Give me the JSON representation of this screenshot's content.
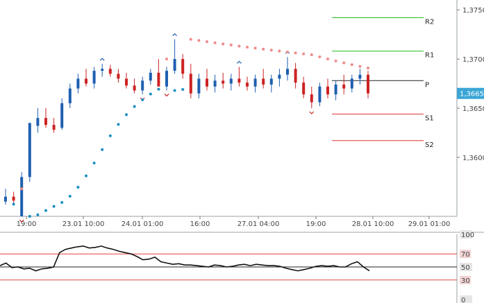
{
  "chart_data": [
    {
      "type": "candlestick",
      "title": "",
      "price_axis": {
        "ticks": [
          "1,3750",
          "1,3700",
          "1,3650",
          "1,3600"
        ],
        "tick_values": [
          1.375,
          1.37,
          1.365,
          1.36
        ],
        "current_price_label": "1,3665",
        "current_price": 1.3665,
        "ylim": [
          1.354,
          1.376
        ]
      },
      "time_axis": {
        "ticks": [
          "19:00",
          "23.01 10:00",
          "24.01 01:00",
          "16:00",
          "27.01 04:00",
          "19:00",
          "28.01 10:00",
          "29.01 01:00"
        ]
      },
      "pivot_levels": [
        {
          "label": "R2",
          "value": 1.3742,
          "color": "#22bb22"
        },
        {
          "label": "R1",
          "value": 1.3708,
          "color": "#22bb22"
        },
        {
          "label": "P",
          "value": 1.3678,
          "color": "#222222"
        },
        {
          "label": "S1",
          "value": 1.3644,
          "color": "#dd3333"
        },
        {
          "label": "S2",
          "value": 1.3617,
          "color": "#dd3333"
        }
      ],
      "colors": {
        "bull": "#1f5fb0",
        "bear": "#cc2222",
        "sar_down": "#ef8a8a",
        "sar_up": "#1a8fc4"
      },
      "candles": [
        [
          1.3555,
          1.3568,
          1.3552,
          1.356
        ],
        [
          1.356,
          1.3565,
          1.3553,
          1.3556
        ],
        [
          1.354,
          1.3585,
          1.354,
          1.358
        ],
        [
          1.358,
          1.362,
          1.3575,
          1.3635
        ],
        [
          1.3632,
          1.365,
          1.3625,
          1.364
        ],
        [
          1.364,
          1.365,
          1.363,
          1.3633
        ],
        [
          1.3633,
          1.364,
          1.3625,
          1.3628
        ],
        [
          1.363,
          1.366,
          1.3628,
          1.3655
        ],
        [
          1.3655,
          1.3675,
          1.365,
          1.367
        ],
        [
          1.367,
          1.3685,
          1.3665,
          1.368
        ],
        [
          1.368,
          1.369,
          1.3672,
          1.3675
        ],
        [
          1.3675,
          1.3692,
          1.367,
          1.3688
        ],
        [
          1.3688,
          1.3695,
          1.3682,
          1.369
        ],
        [
          1.369,
          1.3694,
          1.3682,
          1.3685
        ],
        [
          1.3685,
          1.369,
          1.3676,
          1.368
        ],
        [
          1.368,
          1.3686,
          1.367,
          1.3673
        ],
        [
          1.3673,
          1.368,
          1.3665,
          1.3668
        ],
        [
          1.3668,
          1.3682,
          1.3664,
          1.3678
        ],
        [
          1.3678,
          1.369,
          1.3674,
          1.3686
        ],
        [
          1.3686,
          1.37,
          1.368,
          1.3672
        ],
        [
          1.3672,
          1.3692,
          1.3668,
          1.3688
        ],
        [
          1.3688,
          1.372,
          1.3685,
          1.37
        ],
        [
          1.37,
          1.3705,
          1.368,
          1.3685
        ],
        [
          1.3685,
          1.3695,
          1.366,
          1.3665
        ],
        [
          1.3665,
          1.3685,
          1.366,
          1.368
        ],
        [
          1.368,
          1.369,
          1.3668,
          1.3672
        ],
        [
          1.3672,
          1.3684,
          1.3666,
          1.3678
        ],
        [
          1.3678,
          1.3686,
          1.367,
          1.3675
        ],
        [
          1.3675,
          1.3685,
          1.3668,
          1.368
        ],
        [
          1.368,
          1.3692,
          1.3672,
          1.3676
        ],
        [
          1.3676,
          1.3682,
          1.3668,
          1.3672
        ],
        [
          1.3672,
          1.3684,
          1.3666,
          1.368
        ],
        [
          1.368,
          1.369,
          1.367,
          1.3674
        ],
        [
          1.3674,
          1.3684,
          1.3666,
          1.368
        ],
        [
          1.368,
          1.369,
          1.3672,
          1.3684
        ],
        [
          1.3684,
          1.3702,
          1.3678,
          1.369
        ],
        [
          1.369,
          1.3696,
          1.367,
          1.3676
        ],
        [
          1.3676,
          1.3682,
          1.366,
          1.3664
        ],
        [
          1.3664,
          1.3672,
          1.365,
          1.3656
        ],
        [
          1.3656,
          1.3676,
          1.3652,
          1.3672
        ],
        [
          1.3672,
          1.368,
          1.366,
          1.3664
        ],
        [
          1.3664,
          1.3678,
          1.3658,
          1.3674
        ],
        [
          1.3674,
          1.3684,
          1.3664,
          1.367
        ],
        [
          1.367,
          1.3684,
          1.3666,
          1.368
        ],
        [
          1.368,
          1.369,
          1.3674,
          1.3684
        ],
        [
          1.3684,
          1.3688,
          1.366,
          1.3665
        ]
      ]
    },
    {
      "type": "line",
      "title": "",
      "ylim": [
        0,
        100
      ],
      "y_ticks": [
        "100",
        "70",
        "50",
        "30",
        "0"
      ],
      "tick_values": [
        100,
        70,
        50,
        30,
        0
      ],
      "reference_lines": [
        {
          "value": 70,
          "color": "#dd4444"
        },
        {
          "value": 50,
          "color": "#222222"
        },
        {
          "value": 30,
          "color": "#dd4444"
        }
      ],
      "series": [
        {
          "values": [
            52,
            56,
            49,
            50,
            47,
            48,
            44,
            47,
            48,
            50,
            72,
            77,
            79,
            81,
            82,
            79,
            80,
            82,
            79,
            77,
            74,
            72,
            70,
            66,
            61,
            62,
            65,
            58,
            56,
            54,
            55,
            53,
            53,
            52,
            51,
            50,
            53,
            52,
            50,
            51,
            53,
            54,
            52,
            54,
            53,
            52,
            52,
            51,
            48,
            46,
            44,
            46,
            48,
            51,
            52,
            51,
            52,
            50,
            50,
            55,
            58,
            50,
            44
          ]
        }
      ]
    }
  ]
}
